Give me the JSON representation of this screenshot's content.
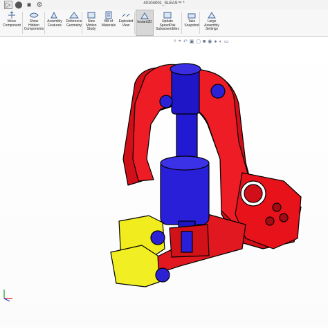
{
  "window": {
    "title": "40104001_SLEAS™ *"
  },
  "quick_access": [
    {
      "name": "select-icon",
      "glyph": "▷"
    },
    {
      "name": "drop-icon",
      "glyph": "⬤"
    },
    {
      "name": "rebuild-icon",
      "glyph": "■"
    },
    {
      "name": "options-icon",
      "glyph": "⚙"
    }
  ],
  "ribbon": {
    "buttons": [
      {
        "name": "move-component-button",
        "label": "Move\nComponent",
        "icon": "move-component-icon",
        "dropdown": true
      },
      {
        "name": "show-hidden-components-button",
        "label": "Show\nHidden\nComponents",
        "icon": "show-hidden-icon"
      },
      {
        "name": "assembly-features-button",
        "label": "Assembly\nFeatures",
        "icon": "assembly-features-icon"
      },
      {
        "name": "reference-geometry-button",
        "label": "Reference\nGeometry",
        "icon": "reference-geometry-icon"
      },
      {
        "name": "new-motion-study-button",
        "label": "New\nMotion\nStudy",
        "icon": "motion-study-icon"
      },
      {
        "name": "bill-of-materials-button",
        "label": "Bill of\nMaterials",
        "icon": "bom-icon"
      },
      {
        "name": "exploded-view-button",
        "label": "Exploded\nView",
        "icon": "exploded-view-icon"
      },
      {
        "name": "instant3d-button",
        "label": "Instant3D",
        "icon": "instant3d-icon",
        "active": true
      },
      {
        "name": "update-speedpak-button",
        "label": "Update\nSpeedPak\nSubassemblies",
        "icon": "speedpak-icon"
      },
      {
        "name": "take-snapshot-button",
        "label": "Take\nSnapshot",
        "icon": "snapshot-icon"
      },
      {
        "name": "large-assembly-settings-button",
        "label": "Large\nAssembly\nSettings",
        "icon": "large-assembly-icon"
      }
    ]
  },
  "heads_up_toolbar": [
    {
      "name": "zoom-to-fit-icon",
      "glyph": "⌕"
    },
    {
      "name": "zoom-area-icon",
      "glyph": "⌖"
    },
    {
      "name": "previous-view-icon",
      "glyph": "↶"
    },
    {
      "name": "section-view-icon",
      "glyph": "▣"
    },
    {
      "name": "view-orientation-icon",
      "glyph": "▢"
    },
    {
      "name": "display-style-icon",
      "glyph": "■"
    },
    {
      "name": "hide-show-icon",
      "glyph": "◉"
    },
    {
      "name": "appearance-icon",
      "glyph": "●"
    },
    {
      "name": "scene-icon",
      "glyph": "◐"
    },
    {
      "name": "view-settings-icon",
      "glyph": "▭"
    }
  ],
  "colors": {
    "frame": "#e8121b",
    "cylinder": "#2419d6",
    "clamp": "#e8e81c",
    "edge": "#000000",
    "view_bg": "#ffffff"
  }
}
